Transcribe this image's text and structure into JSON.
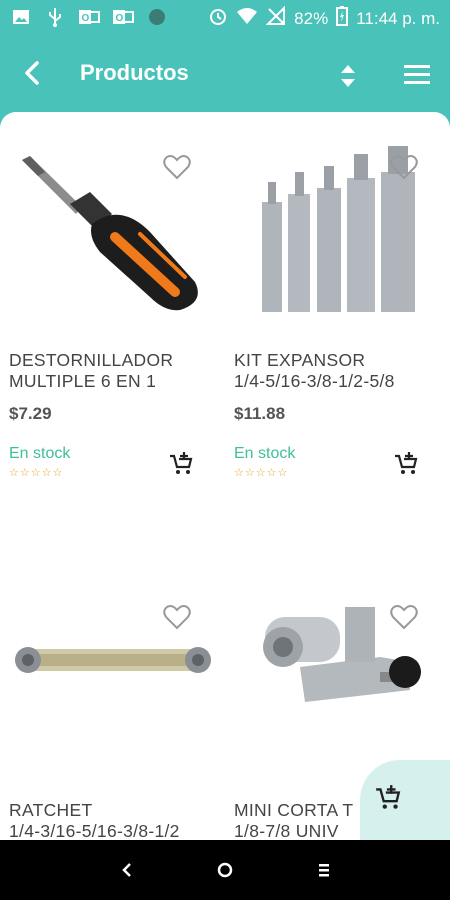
{
  "status_bar": {
    "battery": "82%",
    "time": "11:44 p. m.",
    "icons": [
      "image-icon",
      "usb-icon",
      "outlook-icon",
      "outlook-icon",
      "circle-icon",
      "alarm-icon",
      "wifi-icon",
      "no-signal-icon",
      "battery-charging-icon"
    ]
  },
  "app_bar": {
    "title": "Productos",
    "icons": [
      "back-arrow-icon",
      "sort-icon",
      "hamburger-menu-icon"
    ]
  },
  "products": [
    {
      "name_line1": "DESTORNILLADOR",
      "name_line2": "MULTIPLE 6 EN 1",
      "price": "$7.29",
      "stock": "En stock",
      "stars": "☆☆☆☆☆",
      "image": "screwdriver"
    },
    {
      "name_line1": "KIT EXPANSOR",
      "name_line2": "1/4-5/16-3/8-1/2-5/8",
      "price": "$11.88",
      "stock": "En stock",
      "stars": "☆☆☆☆☆",
      "image": "expander-kit"
    },
    {
      "name_line1": "RATCHET",
      "name_line2": "1/4-3/16-5/16-3/8-1/2",
      "image": "ratchet-wrench"
    },
    {
      "name_line1": "MINI CORTA T",
      "name_line2": "1/8-7/8  UNIV",
      "image": "tube-cutter"
    }
  ],
  "colors": {
    "accent": "#49c3b9",
    "stock_green": "#3fbf9a",
    "star_orange": "#e9a524",
    "fab_bg": "#d6f0ee"
  }
}
